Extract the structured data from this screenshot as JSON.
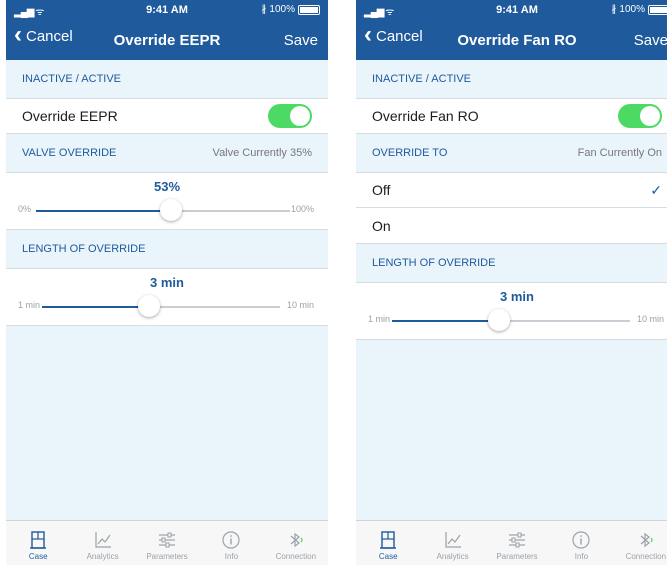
{
  "status_bar": {
    "time": "9:41 AM",
    "battery": "100%"
  },
  "tabs": [
    {
      "label": "Case",
      "icon": "case-icon"
    },
    {
      "label": "Analytics",
      "icon": "analytics-icon"
    },
    {
      "label": "Parameters",
      "icon": "parameters-icon"
    },
    {
      "label": "Info",
      "icon": "info-icon"
    },
    {
      "label": "Connection",
      "icon": "bluetooth-icon"
    }
  ],
  "screen1": {
    "nav": {
      "back": "Cancel",
      "title": "Override EEPR",
      "save": "Save"
    },
    "active_header": "INACTIVE / ACTIVE",
    "toggle_label": "Override EEPR",
    "toggle_on": true,
    "valve_header": "VALVE OVERRIDE",
    "valve_current": "Valve Currently 35%",
    "valve_slider": {
      "value": "53%",
      "min": "0%",
      "max": "100%",
      "fraction": 0.53
    },
    "length_header": "LENGTH OF OVERRIDE",
    "length_slider": {
      "value": "3 min",
      "min": "1 min",
      "max": "10 min",
      "fraction": 0.45
    }
  },
  "screen2": {
    "nav": {
      "back": "Cancel",
      "title": "Override Fan RO",
      "save": "Save"
    },
    "active_header": "INACTIVE / ACTIVE",
    "toggle_label": "Override Fan RO",
    "toggle_on": true,
    "override_header": "OVERRIDE TO",
    "fan_current": "Fan Currently On",
    "options": [
      {
        "label": "Off",
        "selected": true
      },
      {
        "label": "On",
        "selected": false
      }
    ],
    "length_header": "LENGTH OF OVERRIDE",
    "length_slider": {
      "value": "3 min",
      "min": "1 min",
      "max": "10 min",
      "fraction": 0.45
    }
  },
  "colors": {
    "brand": "#1f5a9c",
    "toggle_on": "#4cd964",
    "background": "#eaf4fb"
  }
}
